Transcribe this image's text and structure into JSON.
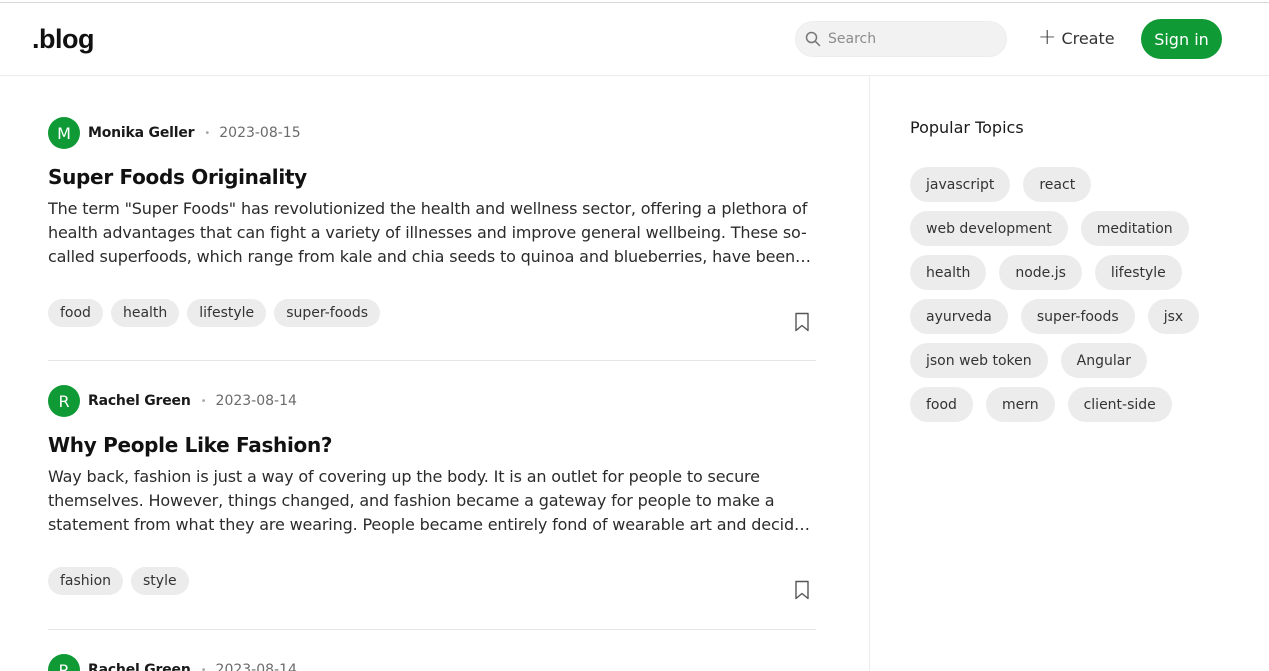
{
  "header": {
    "logo": ".blog",
    "search_placeholder": "Search",
    "create_label": "Create",
    "signin_label": "Sign in"
  },
  "posts": [
    {
      "avatar": "M",
      "author": "Monika Geller",
      "date": "2023-08-15",
      "title": "Super Foods Originality",
      "excerpt": "The term \"Super Foods\" has revolutionized the health and wellness sector, offering a plethora of health advantages that can fight a variety of illnesses and improve general wellbeing. These so-called superfoods, which range from kale and chia seeds to quinoa and blueberries, have been aggressively...",
      "tags": [
        "food",
        "health",
        "lifestyle",
        "super-foods"
      ]
    },
    {
      "avatar": "R",
      "author": "Rachel Green",
      "date": "2023-08-14",
      "title": "Why People Like Fashion?",
      "excerpt": "Way back, fashion is just a way of covering up the body. It is an outlet for people to secure themselves. However, things changed, and fashion became a gateway for people to make a statement from what they are wearing. People became entirely fond of wearable art and decided to put effort into it. With...",
      "tags": [
        "fashion",
        "style"
      ]
    },
    {
      "avatar": "R",
      "author": "Rachel Green",
      "date": "2023-08-14"
    }
  ],
  "sidebar": {
    "title": "Popular Topics",
    "topics": [
      "javascript",
      "react",
      "web development",
      "meditation",
      "health",
      "node.js",
      "lifestyle",
      "ayurveda",
      "super-foods",
      "jsx",
      "json web token",
      "Angular",
      "food",
      "mern",
      "client-side"
    ]
  },
  "colors": {
    "accent": "#0f9a35",
    "chip_bg": "#ececec"
  },
  "icons": {
    "search": "search-icon",
    "create": "plus-icon",
    "bookmark": "bookmark-icon"
  }
}
